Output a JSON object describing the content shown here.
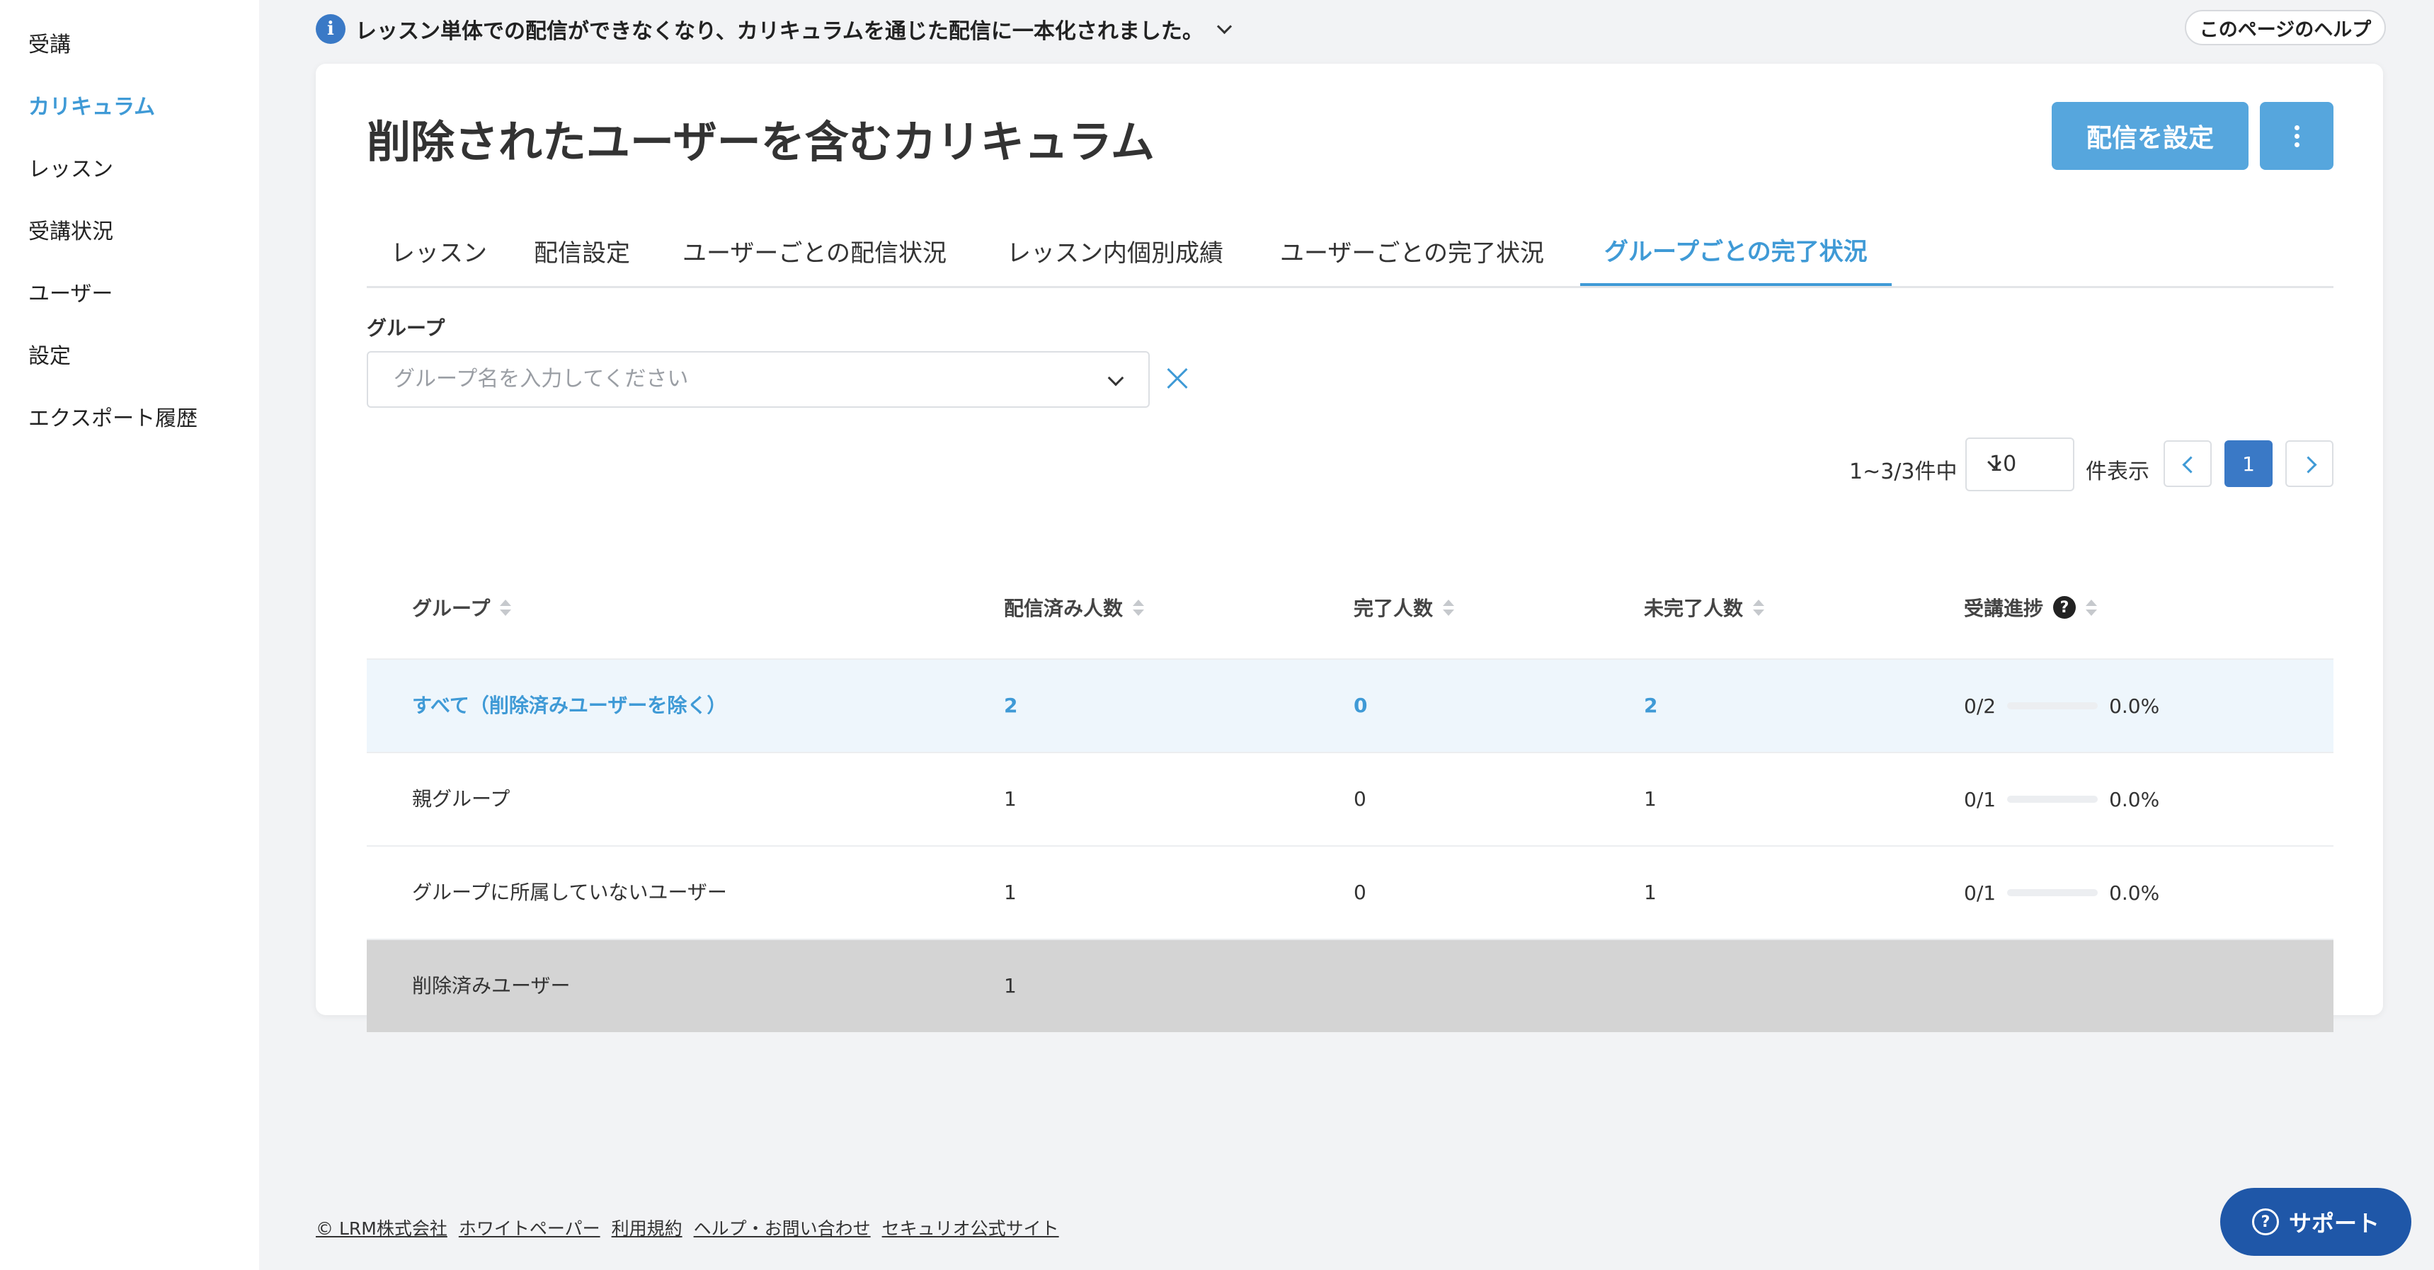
{
  "sidebar": {
    "items": [
      {
        "label": "受講"
      },
      {
        "label": "カリキュラム",
        "active": true
      },
      {
        "label": "レッスン"
      },
      {
        "label": "受講状況"
      },
      {
        "label": "ユーザー"
      },
      {
        "label": "設定"
      },
      {
        "label": "エクスポート履歴"
      }
    ]
  },
  "notice": {
    "text": "レッスン単体での配信ができなくなり、カリキュラムを通じた配信に一本化されました。",
    "icon": "info-icon"
  },
  "help_button": "このページのヘルプ",
  "page": {
    "title": "削除されたユーザーを含むカリキュラム",
    "primary_button": "配信を設定",
    "more_button_icon": "more-vertical-icon"
  },
  "tabs": [
    {
      "label": "レッスン"
    },
    {
      "label": "配信設定"
    },
    {
      "label": "ユーザーごとの配信状況"
    },
    {
      "label": "レッスン内個別成績"
    },
    {
      "label": "ユーザーごとの完了状況"
    },
    {
      "label": "グループごとの完了状況",
      "active": true
    }
  ],
  "filter": {
    "label": "グループ",
    "placeholder": "グループ名を入力してください"
  },
  "pagination": {
    "range_text": "1~3/3件中",
    "per_page": "10",
    "per_page_suffix": "件表示",
    "current_page": "1"
  },
  "table": {
    "columns": [
      "グループ",
      "配信済み人数",
      "完了人数",
      "未完了人数",
      "受講進捗"
    ],
    "rows": [
      {
        "group": "すべて（削除済みユーザーを除く）",
        "delivered": "2",
        "completed": "0",
        "incomplete": "2",
        "progress_count": "0/2",
        "progress_pct": "0.0%",
        "progress_value": 0,
        "style": "highlight"
      },
      {
        "group": "親グループ",
        "delivered": "1",
        "completed": "0",
        "incomplete": "1",
        "progress_count": "0/1",
        "progress_pct": "0.0%",
        "progress_value": 0
      },
      {
        "group": "グループに所属していないユーザー",
        "delivered": "1",
        "completed": "0",
        "incomplete": "1",
        "progress_count": "0/1",
        "progress_pct": "0.0%",
        "progress_value": 0
      },
      {
        "group": "削除済みユーザー",
        "delivered": "1",
        "completed": "",
        "incomplete": "",
        "progress_count": "",
        "progress_pct": "",
        "style": "deleted"
      }
    ]
  },
  "footer": {
    "links": [
      "© LRM株式会社",
      "ホワイトペーパー",
      "利用規約",
      "ヘルプ・お問い合わせ",
      "セキュリオ公式サイト"
    ]
  },
  "support_button": "サポート",
  "colors": {
    "accent": "#3f9ad6",
    "primary_button": "#56a6dd",
    "active_page": "#3a79c6",
    "support": "#1f57a8",
    "background": "#f2f3f5"
  }
}
